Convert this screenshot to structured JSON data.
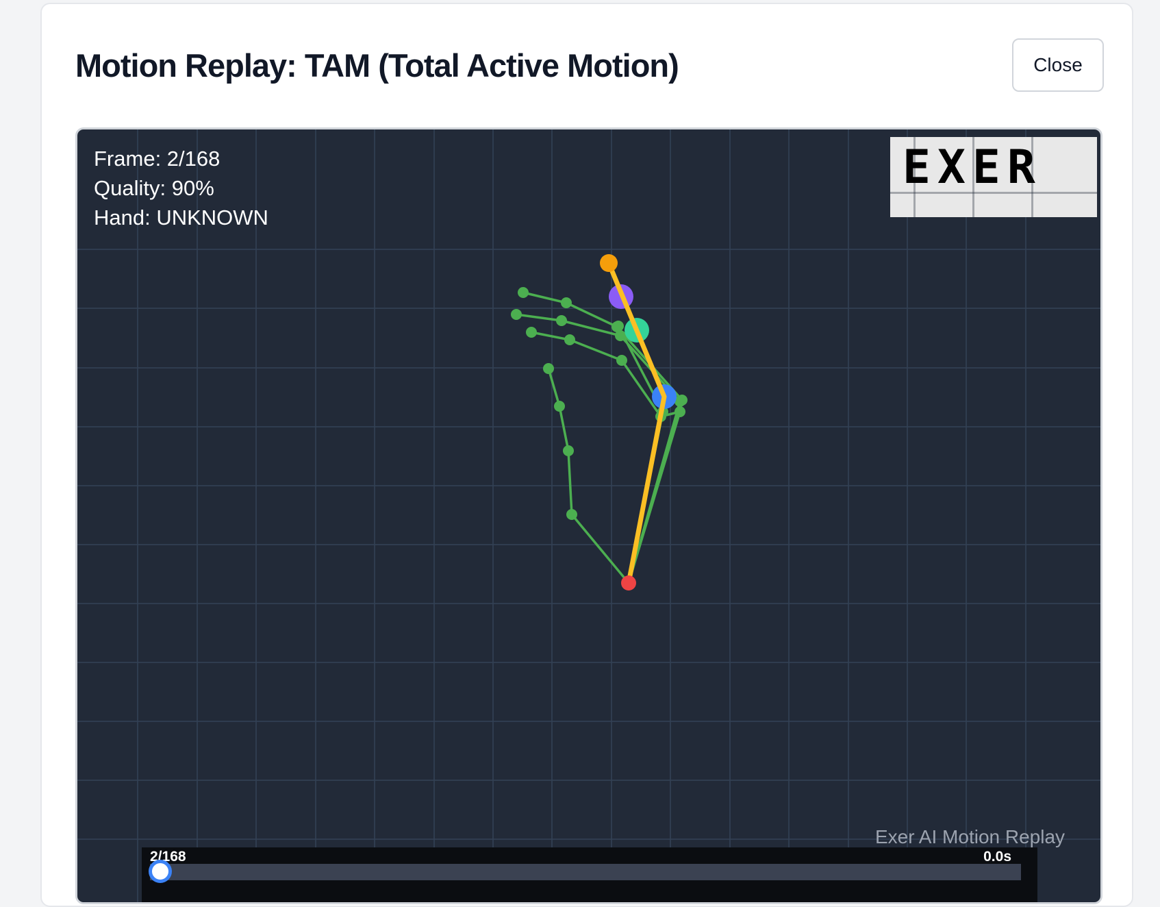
{
  "modal": {
    "title": "Motion Replay: TAM (Total Active Motion)",
    "close_label": "Close"
  },
  "replay": {
    "frame_text": "Frame: 2/168",
    "quality_text": "Quality: 90%",
    "hand_text": "Hand: UNKNOWN",
    "logo_text": "EXER",
    "watermark": "Exer AI Motion Replay",
    "timeline_frame": "2/168",
    "timeline_time": "0.0s",
    "current_frame": 2,
    "total_frames": 168
  },
  "colors": {
    "canvas_bg": "#222a38",
    "grid": "#334155",
    "skeleton": "#4caf50",
    "tam_line": "#fbbf24",
    "wrist": "#ef4444",
    "tip": "#f59e0b",
    "purple_joint": "#8b5cf6",
    "teal_joint": "#34d399",
    "blue_joint": "#3b82f6"
  }
}
